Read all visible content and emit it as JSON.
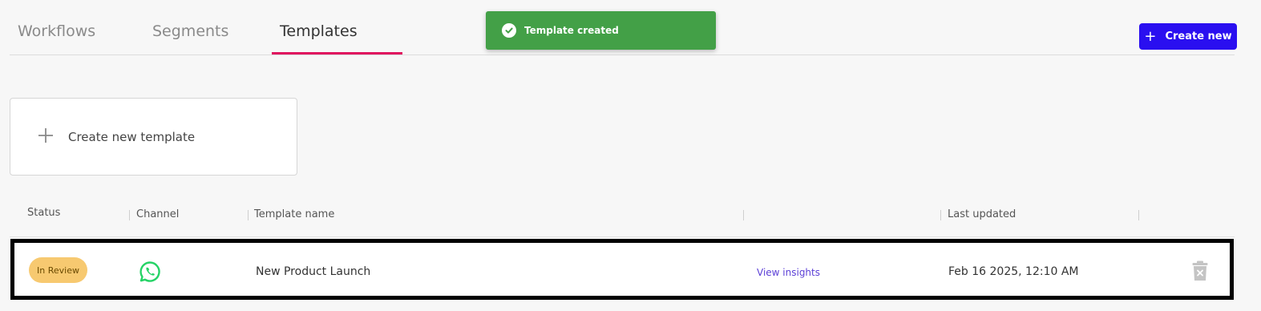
{
  "tabs": [
    {
      "label": "Workflows",
      "active": false
    },
    {
      "label": "Segments",
      "active": false
    },
    {
      "label": "Templates",
      "active": true
    }
  ],
  "toast": {
    "message": "Template created",
    "color": "#43a047",
    "icon": "check-circle-icon"
  },
  "create_button": {
    "label": "Create new",
    "icon": "plus-icon",
    "color": "#2a0ff0"
  },
  "new_template_card": {
    "label": "Create new template",
    "icon": "plus-icon"
  },
  "table": {
    "headers": [
      "Status",
      "Channel",
      "Template name",
      "",
      "Last updated",
      ""
    ],
    "rows": [
      {
        "status": "In Review",
        "channel_icon": "whatsapp-icon",
        "template_name": "New Product Launch",
        "insights_link": "View insights",
        "last_updated": "Feb 16 2025, 12:10 AM",
        "action_icon": "trash-icon"
      }
    ]
  },
  "colors": {
    "accent": "#e0115f",
    "badge": "#f7c970",
    "link": "#5b3fd6",
    "whatsapp": "#25d366"
  }
}
